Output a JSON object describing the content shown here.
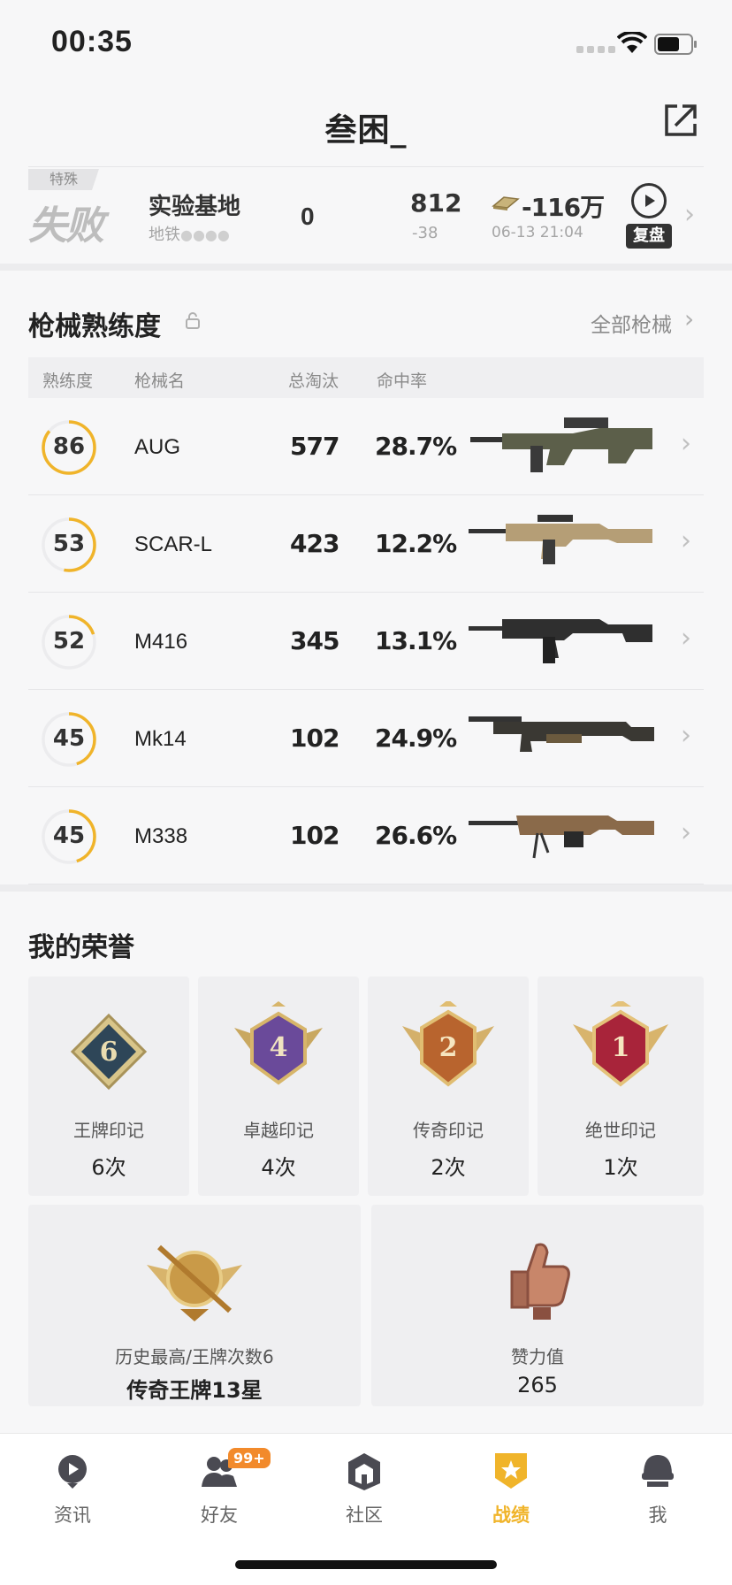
{
  "status_bar": {
    "time": "00:35"
  },
  "header": {
    "title": "叁困_"
  },
  "match": {
    "mode_tag": "特殊",
    "result": "失败",
    "map": "实验基地",
    "map_sub": "地铁",
    "kills": "0",
    "rank_value": "812",
    "rank_change": "-38",
    "money": "-116万",
    "time": "06-13 21:04",
    "replay_label": "复盘"
  },
  "weapons": {
    "title": "枪械熟练度",
    "all_link": "全部枪械",
    "headers": [
      "熟练度",
      "枪械名",
      "总淘汰",
      "命中率"
    ],
    "rows": [
      {
        "proficiency": "86",
        "fill": 0.86,
        "name": "AUG",
        "kills": "577",
        "accuracy": "28.7%"
      },
      {
        "proficiency": "53",
        "fill": 0.53,
        "name": "SCAR-L",
        "kills": "423",
        "accuracy": "12.2%"
      },
      {
        "proficiency": "52",
        "fill": 0.2,
        "name": "M416",
        "kills": "345",
        "accuracy": "13.1%"
      },
      {
        "proficiency": "45",
        "fill": 0.45,
        "name": "Mk14",
        "kills": "102",
        "accuracy": "24.9%"
      },
      {
        "proficiency": "45",
        "fill": 0.45,
        "name": "M338",
        "kills": "102",
        "accuracy": "26.6%"
      }
    ]
  },
  "honors": {
    "title": "我的荣誉",
    "items": [
      {
        "badge": "6",
        "label": "王牌印记",
        "count": "6次"
      },
      {
        "badge": "4",
        "label": "卓越印记",
        "count": "4次"
      },
      {
        "badge": "2",
        "label": "传奇印记",
        "count": "2次"
      },
      {
        "badge": "1",
        "label": "绝世印记",
        "count": "1次"
      }
    ],
    "highest_label": "历史最高/王牌次数6",
    "highest_value": "传奇王牌13星",
    "likes_label": "赞力值",
    "likes_value": "265"
  },
  "tabbar": {
    "items": [
      {
        "label": "资讯",
        "icon": "news-icon"
      },
      {
        "label": "好友",
        "icon": "friends-icon"
      },
      {
        "label": "社区",
        "icon": "community-icon"
      },
      {
        "label": "战绩",
        "icon": "record-icon"
      },
      {
        "label": "我",
        "icon": "profile-icon"
      }
    ],
    "friends_badge": "99+"
  },
  "colors": {
    "accent": "#f0b42a",
    "ring": "#f0b42a",
    "ring_bg": "#e8e8ea"
  }
}
